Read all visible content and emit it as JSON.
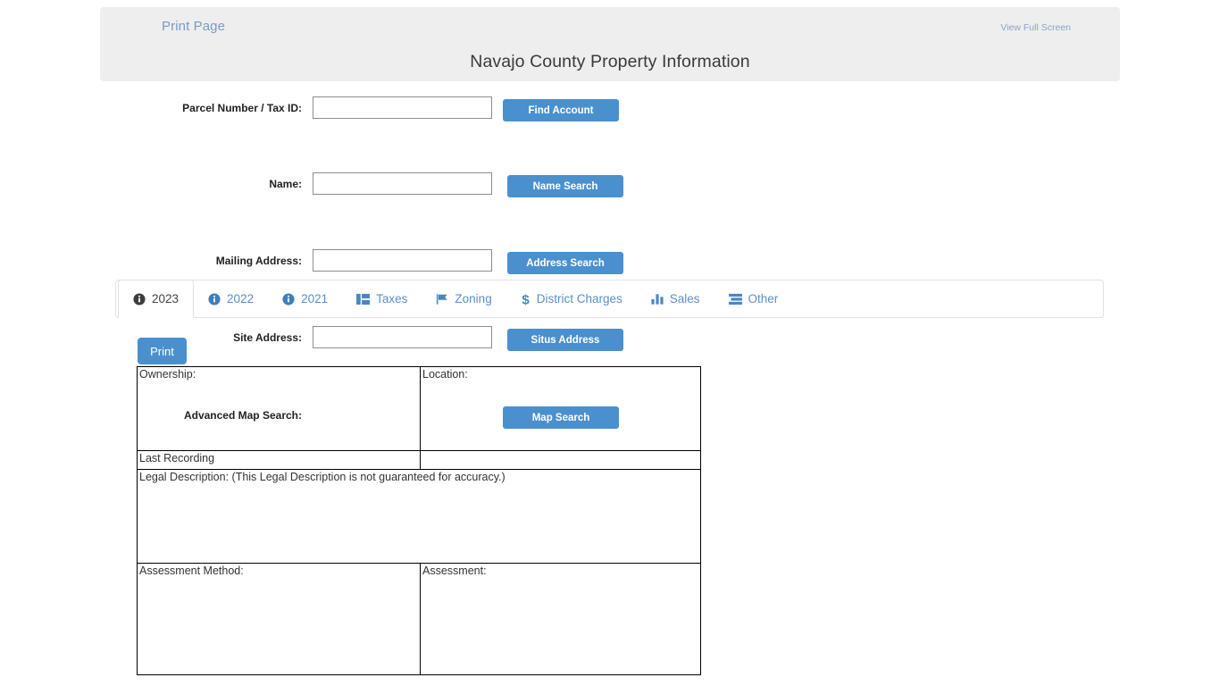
{
  "header": {
    "print_page_label": "Print Page",
    "view_full_screen_label": "View Full Screen",
    "title": "Navajo County Property Information"
  },
  "search_form": {
    "rows": [
      {
        "label": "Parcel Number / Tax ID:",
        "value": "",
        "placeholder": "",
        "button": "Find Account"
      },
      {
        "label": "Name:",
        "value": "",
        "placeholder": "",
        "button": "Name Search"
      },
      {
        "label": "Mailing Address:",
        "value": "",
        "placeholder": "",
        "button": "Address Search"
      },
      {
        "label": "Site Address:",
        "value": "",
        "placeholder": "",
        "button": "Situs Address"
      },
      {
        "label": "Advanced Map Search:",
        "value": null,
        "placeholder": "",
        "button": "Map Search"
      }
    ]
  },
  "tabs": {
    "active_index": 0,
    "items": [
      {
        "label": "2023",
        "icon": "info-circle-icon",
        "active": true
      },
      {
        "label": "2022",
        "icon": "info-circle-icon",
        "active": false
      },
      {
        "label": "2021",
        "icon": "info-circle-icon",
        "active": false
      },
      {
        "label": "Taxes",
        "icon": "columns-icon",
        "active": false
      },
      {
        "label": "Zoning",
        "icon": "flag-icon",
        "active": false
      },
      {
        "label": "District Charges",
        "icon": "dollar-sign-icon",
        "active": false
      },
      {
        "label": "Sales",
        "icon": "bar-chart-icon",
        "active": false
      },
      {
        "label": "Other",
        "icon": "server-list-icon",
        "active": false
      }
    ]
  },
  "content": {
    "print_button_label": "Print",
    "table": {
      "ownership_label": "Ownership:",
      "ownership_value": "",
      "location_label": "Location:",
      "location_value": "",
      "last_recording_label": "Last Recording",
      "last_recording_value": "",
      "legal_description_label": "Legal Description: (This Legal Description is not guaranteed for accuracy.)",
      "legal_description_value": "",
      "assessment_method_label": "Assessment Method:",
      "assessment_method_value": "",
      "assessment_label": "Assessment:",
      "assessment_value": ""
    }
  },
  "colors": {
    "accent_blue": "#4a90ce",
    "link_blue": "#7b9bc4",
    "tab_blue": "#5b8fc9",
    "header_bg": "#eeeeee",
    "page_bg": "#ffffff"
  }
}
